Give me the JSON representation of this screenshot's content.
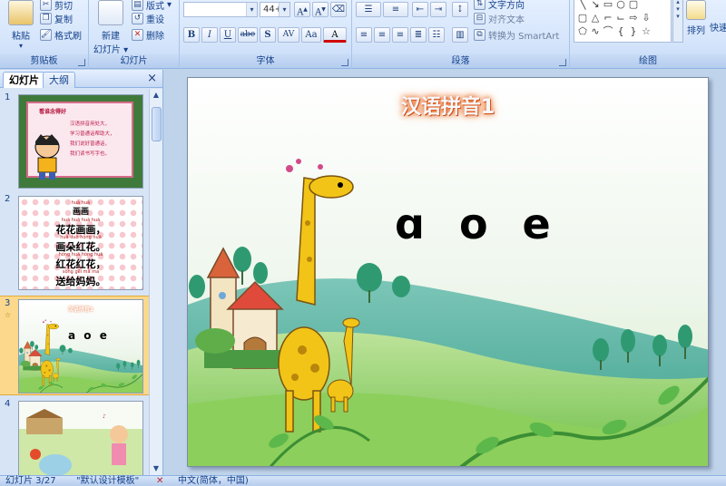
{
  "ribbon": {
    "clipboard": {
      "paste": "粘贴",
      "cut": "剪切",
      "copy": "复制",
      "format_painter": "格式刷",
      "label": "剪贴板"
    },
    "slides": {
      "new_slide": "新建",
      "new_slide_2": "幻灯片",
      "layout": "版式",
      "reset": "重设",
      "delete": "删除",
      "label": "幻灯片"
    },
    "font": {
      "size": "44+",
      "label": "字体",
      "buttons": [
        "B",
        "I",
        "U",
        "abe",
        "S",
        "AV",
        "Aa",
        "A"
      ]
    },
    "paragraph": {
      "text_direction": "文字方向",
      "align_text": "对齐文本",
      "smartart": "转换为 SmartArt",
      "label": "段落"
    },
    "drawing": {
      "arrange": "排列",
      "quick_styles": "快速",
      "label": "绘图"
    }
  },
  "left_pane": {
    "tabs": [
      "幻灯片",
      "大纲"
    ],
    "close": "×",
    "slides": [
      {
        "num": "1",
        "title": "看谁念得好",
        "lines": [
          "汉语拼音用处大，",
          "学习普通话帮助大，",
          "我们说好普通话，",
          "我们读书写字也。"
        ]
      },
      {
        "num": "2",
        "pinyin": [
          "huà huà",
          "huā huā huà huà",
          "huā duǒ hóng huā",
          "hóng huā hóng huā",
          "sòng gěi mā ma"
        ],
        "lines": [
          "画画",
          "花花画画，",
          "画朵红花。",
          "红花红花，",
          "送给妈妈。"
        ]
      },
      {
        "num": "3",
        "title": "汉语拼音1",
        "letters": "a o e"
      },
      {
        "num": "4"
      }
    ]
  },
  "slide": {
    "title": "汉语拼音1",
    "letters": "ɑ o e"
  },
  "status": {
    "slide_info": "幻灯片 3/27",
    "theme": "\"默认设计模板\"",
    "lang": "中文(简体，中国)"
  },
  "colors": {
    "ribbon_bg": "#d7e6fb",
    "accent": "#15428b",
    "selected_thumb": "#fbd88b",
    "title_glow": "#f07a2a"
  }
}
